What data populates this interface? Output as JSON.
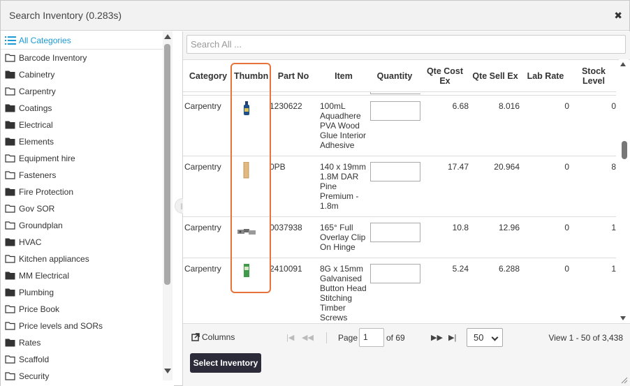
{
  "dialog": {
    "title": "Search Inventory (0.283s)",
    "close_glyph": "✖"
  },
  "sidebar": {
    "all_label": "All Categories",
    "items": [
      {
        "label": "Barcode Inventory",
        "icon": "folder-open"
      },
      {
        "label": "Cabinetry",
        "icon": "folder-closed"
      },
      {
        "label": "Carpentry",
        "icon": "folder-open"
      },
      {
        "label": "Coatings",
        "icon": "folder-closed"
      },
      {
        "label": "Electrical",
        "icon": "folder-closed"
      },
      {
        "label": "Elements",
        "icon": "folder-closed"
      },
      {
        "label": "Equipment hire",
        "icon": "folder-open"
      },
      {
        "label": "Fasteners",
        "icon": "folder-open"
      },
      {
        "label": "Fire Protection",
        "icon": "folder-closed"
      },
      {
        "label": "Gov SOR",
        "icon": "folder-open"
      },
      {
        "label": "Groundplan",
        "icon": "folder-open"
      },
      {
        "label": "HVAC",
        "icon": "folder-closed"
      },
      {
        "label": "Kitchen appliances",
        "icon": "folder-open"
      },
      {
        "label": "MM Electrical",
        "icon": "folder-closed"
      },
      {
        "label": "Plumbing",
        "icon": "folder-closed"
      },
      {
        "label": "Price Book",
        "icon": "folder-open"
      },
      {
        "label": "Price levels and SORs",
        "icon": "folder-open"
      },
      {
        "label": "Rates",
        "icon": "folder-closed"
      },
      {
        "label": "Scaffold",
        "icon": "folder-open"
      },
      {
        "label": "Security",
        "icon": "folder-open"
      }
    ]
  },
  "search": {
    "placeholder": "Search All ..."
  },
  "grid": {
    "headers": [
      "Category",
      "Thumbn",
      "Part No",
      "Item",
      "Quantity",
      "Qte Cost Ex",
      "Qte Sell Ex",
      "Lab Rate",
      "Stock Level"
    ],
    "rows": [
      {
        "category": "Carpentry",
        "thumb": "bottle",
        "part": "1230622",
        "item": "100mL Aquadhere PVA Wood Glue Interior Adhesive",
        "cost": "6.68",
        "sell": "8.016",
        "lab": "0",
        "stock": "0"
      },
      {
        "category": "Carpentry",
        "thumb": "timber",
        "part": "0PB",
        "item": "140 x 19mm 1.8M DAR Pine Premium - 1.8m",
        "cost": "17.47",
        "sell": "20.964",
        "lab": "0",
        "stock": "8"
      },
      {
        "category": "Carpentry",
        "thumb": "hinge",
        "part": "0037938",
        "item": "165° Full Overlay Clip On Hinge",
        "cost": "10.8",
        "sell": "12.96",
        "lab": "0",
        "stock": "1"
      },
      {
        "category": "Carpentry",
        "thumb": "screws",
        "part": "2410091",
        "item": "8G x 15mm Galvanised Button Head Stitching Timber Screws",
        "cost": "5.24",
        "sell": "6.288",
        "lab": "0",
        "stock": "1"
      }
    ]
  },
  "pager": {
    "columns_label": "Columns",
    "page_label": "Page",
    "page_value": "1",
    "of_label": "of 69",
    "per_page": "50",
    "view_label": "View 1 - 50 of 3,438"
  },
  "footer": {
    "select_label": "Select Inventory"
  },
  "colors": {
    "accent": "#1a9bd7",
    "highlight": "#e8733a",
    "button": "#2b2b3a"
  }
}
